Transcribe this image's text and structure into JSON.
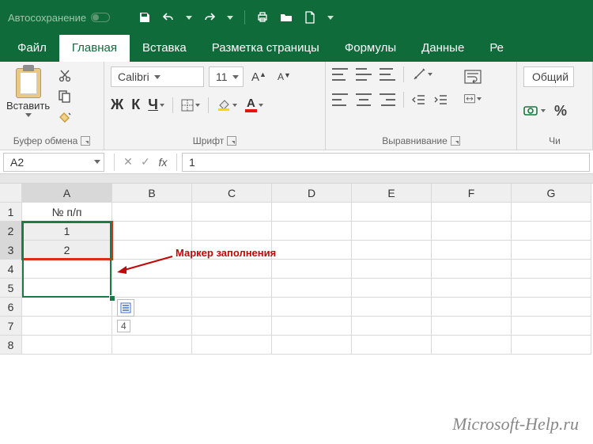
{
  "titlebar": {
    "autosave_label": "Автосохранение"
  },
  "tabs": {
    "file": "Файл",
    "home": "Главная",
    "insert": "Вставка",
    "layout": "Разметка страницы",
    "formulas": "Формулы",
    "data": "Данные",
    "review_partial": "Ре"
  },
  "ribbon": {
    "clipboard": {
      "label": "Буфер обмена",
      "paste": "Вставить"
    },
    "font": {
      "label": "Шрифт",
      "name": "Calibri",
      "size": "11",
      "bold": "Ж",
      "italic": "К",
      "underline": "Ч",
      "fontcolor_letter": "А"
    },
    "alignment": {
      "label": "Выравнивание"
    },
    "number": {
      "label_partial": "Чи",
      "format": "Общий"
    }
  },
  "formula_bar": {
    "name_box": "A2",
    "fx": "fx",
    "value": "1"
  },
  "grid": {
    "columns": [
      "A",
      "B",
      "C",
      "D",
      "E",
      "F",
      "G"
    ],
    "rows": [
      "1",
      "2",
      "3",
      "4",
      "5",
      "6",
      "7",
      "8"
    ],
    "header_cell": "№ п/п",
    "val1": "1",
    "val2": "2",
    "tooltip_val": "4"
  },
  "annotation": {
    "label": "Маркер заполнения"
  },
  "watermark": "Microsoft-Help.ru"
}
